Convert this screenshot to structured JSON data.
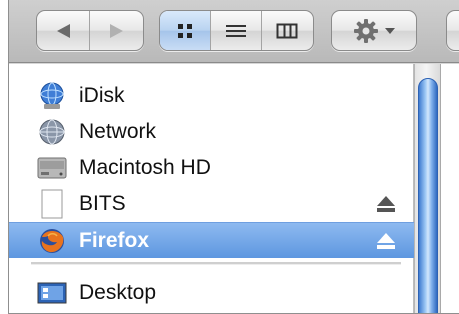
{
  "toolbar": {
    "back_icon": "back-arrow-icon",
    "forward_icon": "forward-arrow-icon",
    "view_icons": [
      "icon-view-icon",
      "list-view-icon",
      "column-view-icon"
    ],
    "selected_view": "icon-view",
    "action_icon": "gear-icon",
    "action_menu_icon": "chevron-down-icon"
  },
  "sidebar": {
    "devices": [
      {
        "label": "iDisk",
        "icon": "idisk-icon",
        "ejectable": false,
        "selected": false
      },
      {
        "label": "Network",
        "icon": "network-globe-icon",
        "ejectable": false,
        "selected": false
      },
      {
        "label": "Macintosh HD",
        "icon": "hard-drive-icon",
        "ejectable": false,
        "selected": false
      },
      {
        "label": "BITS",
        "icon": "disk-image-icon",
        "ejectable": true,
        "selected": false
      },
      {
        "label": "Firefox",
        "icon": "firefox-icon",
        "ejectable": true,
        "selected": true
      }
    ],
    "places": [
      {
        "label": "Desktop",
        "icon": "desktop-icon",
        "selected": false
      }
    ]
  },
  "colors": {
    "selection": "#5d97e0",
    "scroll_thumb": "#3f7bd0",
    "toolbar": "#c4c4c4"
  }
}
